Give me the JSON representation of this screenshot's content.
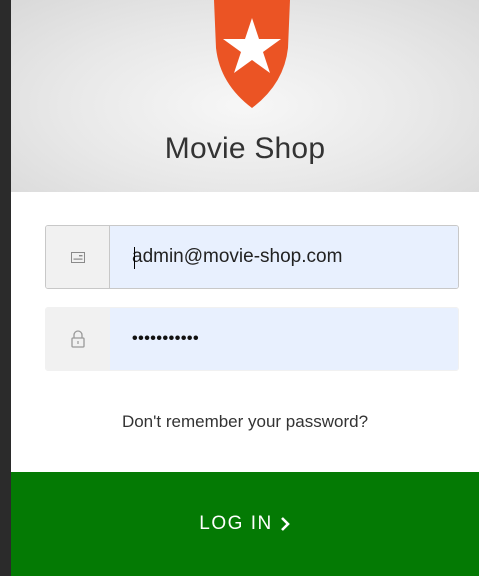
{
  "app": {
    "title": "Movie Shop",
    "logo_icon": "auth0-shield-star-logo",
    "logo_color": "#eb5424"
  },
  "form": {
    "email": {
      "icon": "id-card-icon",
      "value": "admin@movie-shop.com"
    },
    "password": {
      "icon": "lock-icon",
      "masked_value": "•••••••••••"
    },
    "forgot_link": "Don't remember your password?",
    "submit": {
      "label": "LOG IN",
      "icon": "chevron-right-icon",
      "color": "#047a04"
    }
  }
}
